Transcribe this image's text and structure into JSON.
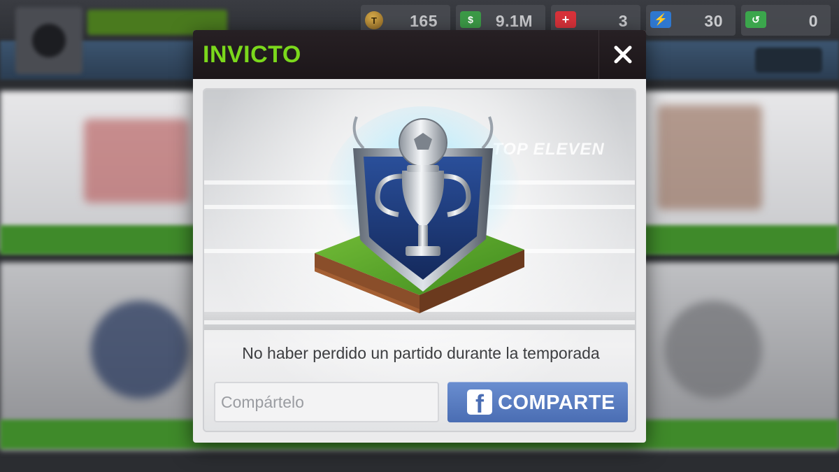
{
  "currency": {
    "tokens": {
      "value": "165",
      "icon": "token-coin-icon"
    },
    "cash": {
      "value": "9.1M",
      "icon": "cash-icon"
    },
    "health": {
      "value": "3",
      "icon": "health-pack-icon"
    },
    "energy": {
      "value": "30",
      "icon": "energy-icon"
    },
    "boost": {
      "value": "0",
      "icon": "rest-icon"
    }
  },
  "dialog": {
    "title": "INVICTO",
    "close_icon": "close-icon",
    "background_logo": "TOP ELEVEN",
    "badge_icon": "trophy-shield-badge-icon",
    "description": "No haber perdido un partido durante la temporada",
    "share_input": {
      "placeholder": "Compártelo",
      "value": ""
    },
    "share_button": {
      "label": "COMPARTE",
      "icon": "facebook-icon"
    }
  },
  "colors": {
    "title": "#7bd81c",
    "header_bg": "#1c1619",
    "facebook_button": "#5a7dc2"
  }
}
